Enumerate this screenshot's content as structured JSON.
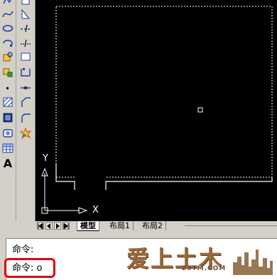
{
  "toolbar_left": {
    "tools": [
      "polyline-icon",
      "spline-icon",
      "ellipse-icon",
      "ellipse-arc-icon",
      "insert-block-icon",
      "make-block-icon",
      "point-icon",
      "hatch-icon",
      "gradient-icon",
      "region-icon",
      "table-icon",
      "multiline-text-icon"
    ],
    "text_tool_label": "A"
  },
  "toolbar_modify": {
    "tools": [
      "stretch-icon",
      "extend-icon",
      "trim-icon",
      "break-icon",
      "break-at-point-icon",
      "join-icon",
      "chamfer-icon",
      "fillet-icon",
      "explode-icon"
    ]
  },
  "ucs": {
    "x_label": "X",
    "y_label": "Y"
  },
  "tabs": [
    {
      "label": "模型",
      "active": true
    },
    {
      "label": "布局1",
      "active": false
    },
    {
      "label": "布局2",
      "active": false
    }
  ],
  "command": {
    "history_line": "命令:",
    "prompt": "命令:",
    "input": "o"
  },
  "watermark": {
    "text": "爱上土木",
    "url": "23TM.COM"
  },
  "colors": {
    "canvas_bg": "#000000",
    "ui_bg": "#d4d0c8",
    "highlight": "#e0000c",
    "watermark": "#9b6a3c"
  }
}
